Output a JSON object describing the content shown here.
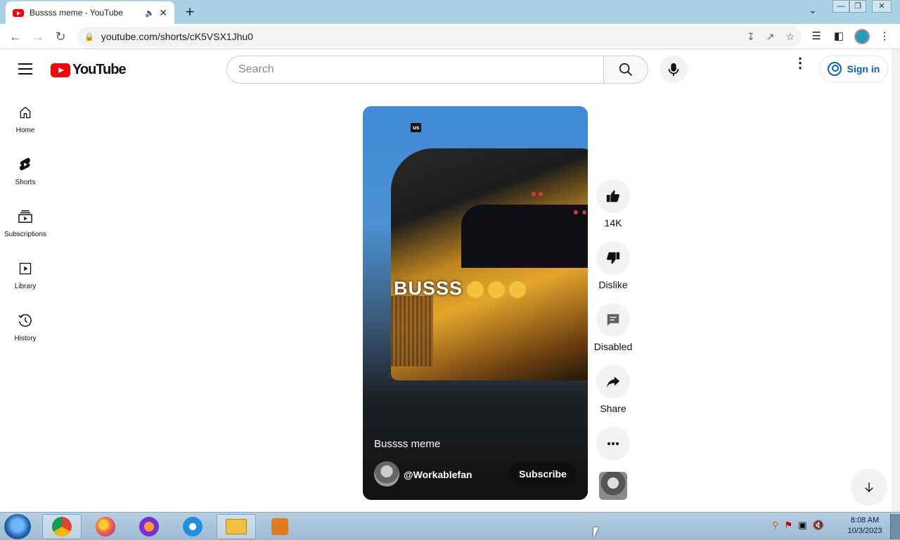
{
  "browser": {
    "tab_title": "Bussss meme - YouTube",
    "url": "youtube.com/shorts/cK5VSX1Jhu0"
  },
  "youtube": {
    "logo_text": "YouTube",
    "search_placeholder": "Search",
    "signin_label": "Sign in",
    "sidebar": [
      {
        "label": "Home",
        "icon": "home-icon"
      },
      {
        "label": "Shorts",
        "icon": "shorts-icon"
      },
      {
        "label": "Subscriptions",
        "icon": "subscriptions-icon"
      },
      {
        "label": "Library",
        "icon": "library-icon"
      },
      {
        "label": "History",
        "icon": "history-icon"
      }
    ],
    "short": {
      "badge": "us",
      "overlay_text": "BUSSS",
      "title": "Bussss meme",
      "channel": "@Workablefan",
      "subscribe_label": "Subscribe"
    },
    "actions": {
      "like_count": "14K",
      "dislike_label": "Dislike",
      "comments_label": "Disabled",
      "share_label": "Share"
    }
  },
  "taskbar": {
    "time": "8:08 AM",
    "date": "10/3/2023"
  },
  "colors": {
    "brand_red": "#ff0000",
    "link_blue": "#065fd4",
    "chrome_frame": "#a9d3e4"
  }
}
